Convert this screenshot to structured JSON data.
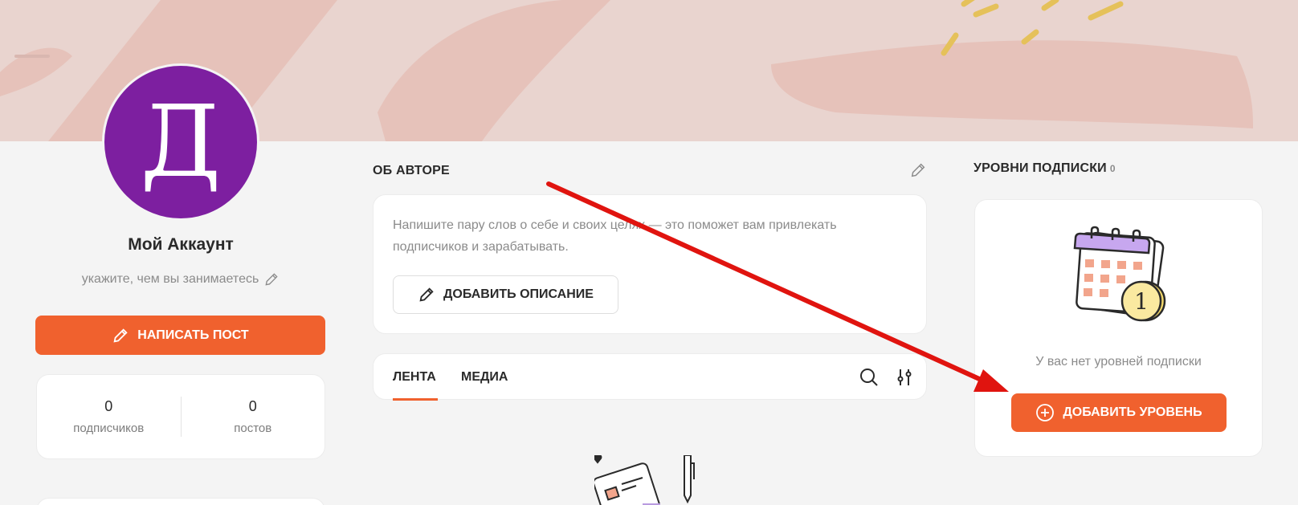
{
  "profile": {
    "avatar_letter": "Д",
    "avatar_color": "#7d1fa0",
    "name": "Мой Аккаунт",
    "occupation_placeholder": "укажите, чем вы занимаетесь",
    "write_post_label": "НАПИСАТЬ ПОСТ",
    "stats": [
      {
        "value": "0",
        "label": "подписчиков"
      },
      {
        "value": "0",
        "label": "постов"
      }
    ]
  },
  "about": {
    "title": "ОБ АВТОРЕ",
    "text": "Напишите пару слов о себе и своих целях — это поможет вам привлекать подписчиков и зарабатывать.",
    "add_description_label": "ДОБАВИТЬ ОПИСАНИЕ"
  },
  "tabs": {
    "items": [
      {
        "label": "ЛЕНТА",
        "active": true
      },
      {
        "label": "МЕДИА",
        "active": false
      }
    ]
  },
  "tiers": {
    "title": "УРОВНИ ПОДПИСКИ",
    "count": "0",
    "empty_text": "У вас нет уровней подписки",
    "add_label": "ДОБАВИТЬ УРОВЕНЬ",
    "calendar_badge": "1"
  },
  "colors": {
    "accent": "#f0612e",
    "banner": "#e9d4cf",
    "annotation_arrow": "#e0140f"
  },
  "icons": [
    "pencil-icon",
    "search-icon",
    "filter-icon",
    "plus-circle-icon",
    "calendar-illustration",
    "feed-illustration"
  ]
}
